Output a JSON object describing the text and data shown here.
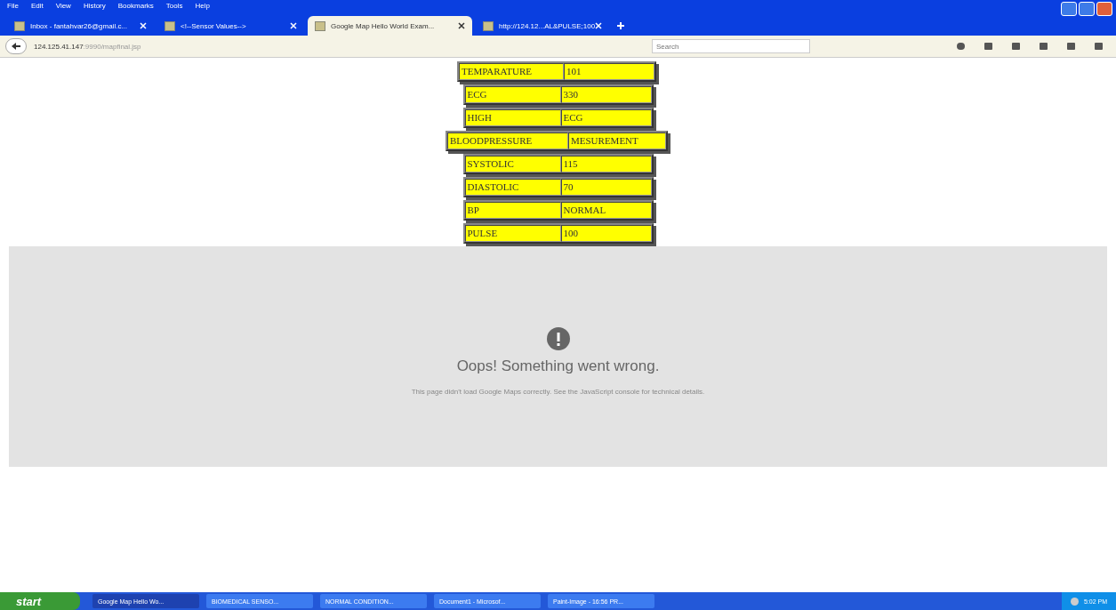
{
  "menu": [
    "File",
    "Edit",
    "View",
    "History",
    "Bookmarks",
    "Tools",
    "Help"
  ],
  "tabs": [
    {
      "label": "Inbox - fantahvar26@gmail.c...",
      "selected": false
    },
    {
      "label": "<!--Sensor Values-->",
      "selected": false
    },
    {
      "label": "Google Map Hello World Exam...",
      "selected": true
    },
    {
      "label": "http://124.12...AL&PULSE;100",
      "selected": false
    }
  ],
  "address": {
    "host": "124.125.41.147",
    "path": ":9990/mapfinal.jsp"
  },
  "search": {
    "placeholder": "Search"
  },
  "readings": [
    {
      "label": "TEMPARATURE",
      "value": "101",
      "kind": "mid"
    },
    {
      "label": "ECG",
      "value": "330",
      "kind": "narrow"
    },
    {
      "label": "HIGH",
      "value": "ECG",
      "kind": "narrow"
    },
    {
      "label": "BLOODPRESSURE",
      "value": "MESUREMENT",
      "kind": "wide"
    },
    {
      "label": "SYSTOLIC",
      "value": "115",
      "kind": "narrow"
    },
    {
      "label": "DIASTOLIC",
      "value": "70",
      "kind": "narrow"
    },
    {
      "label": "BP",
      "value": "NORMAL",
      "kind": "narrow"
    },
    {
      "label": "PULSE",
      "value": "100",
      "kind": "narrow"
    }
  ],
  "map_error": {
    "title": "Oops! Something went wrong.",
    "detail": "This page didn't load Google Maps correctly. See the JavaScript console for technical details."
  },
  "taskbar": {
    "start": "start",
    "items": [
      {
        "label": "Google Map Hello Wo...",
        "selected": true
      },
      {
        "label": "BIOMEDICAL SENSO...",
        "selected": false
      },
      {
        "label": "NORMAL CONDITION...",
        "selected": false
      },
      {
        "label": "Document1 - Microsof...",
        "selected": false
      },
      {
        "label": "Paint-Image - 16:56 PR...",
        "selected": false
      }
    ],
    "clock": "5:02 PM"
  }
}
